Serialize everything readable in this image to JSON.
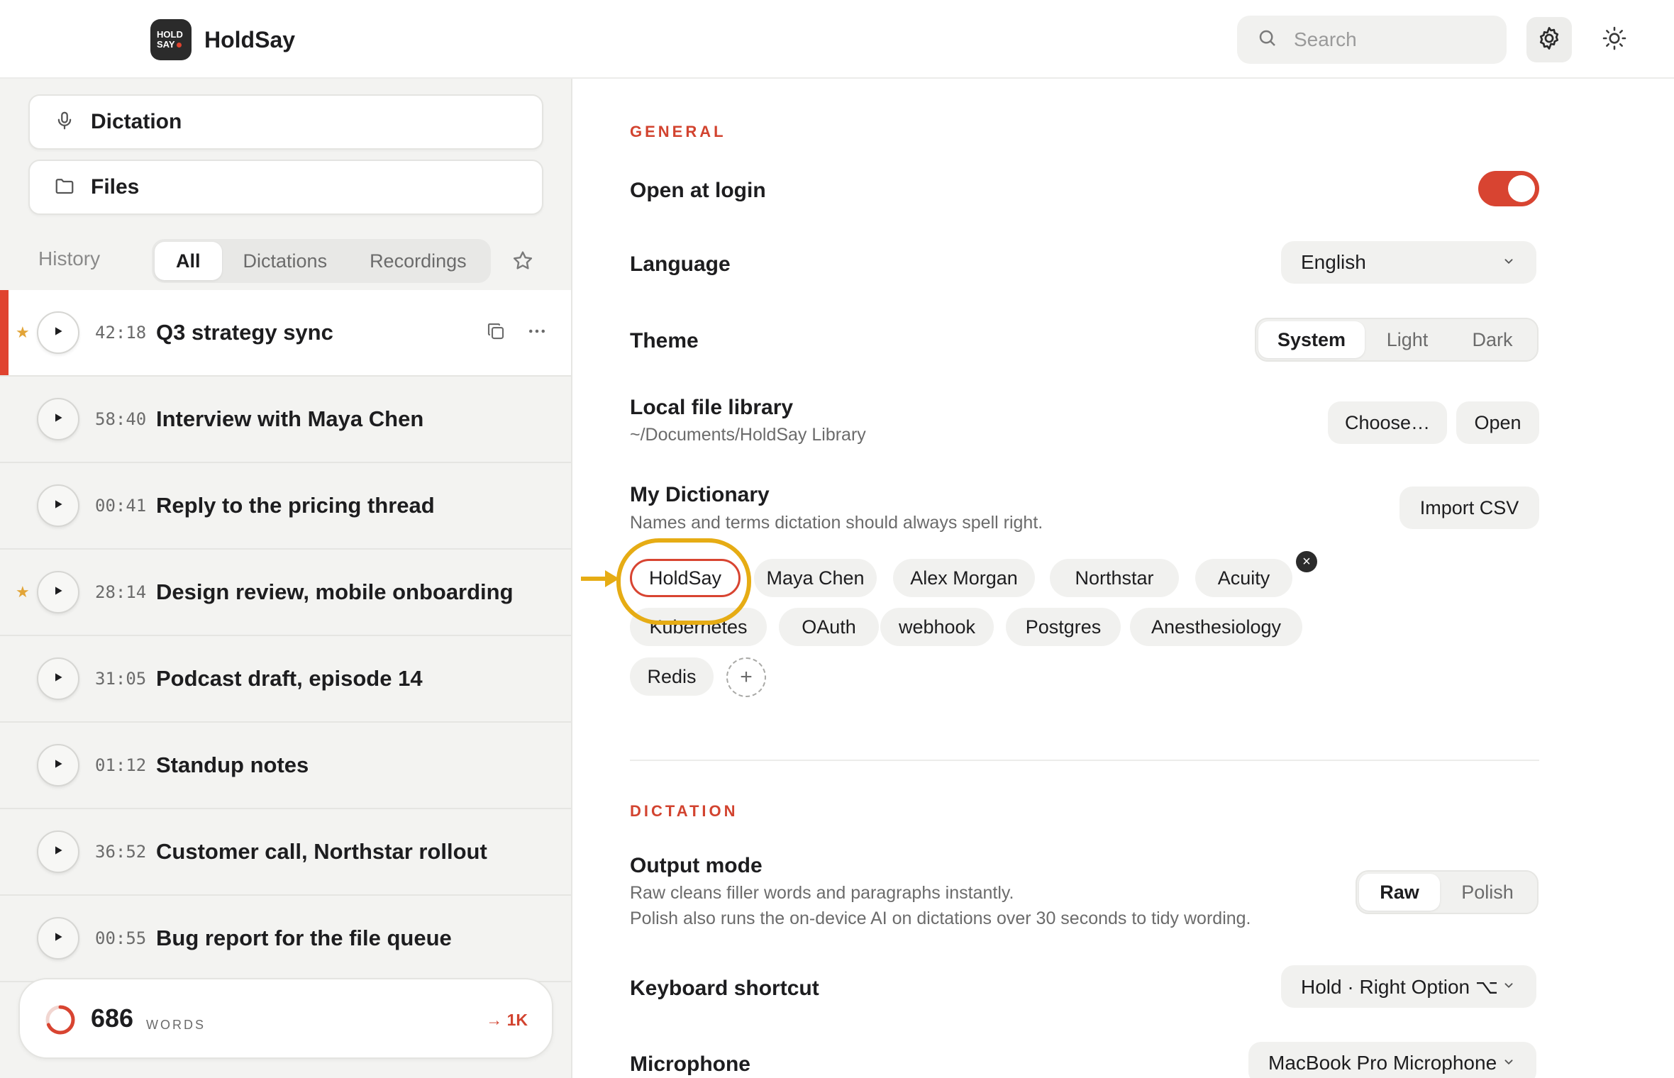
{
  "app": {
    "logo_line1": "HOLD",
    "logo_line2": "SAY",
    "name": "HoldSay"
  },
  "header": {
    "search_placeholder": "Search",
    "icons": [
      "search-icon",
      "gear-icon",
      "sun-icon"
    ]
  },
  "sidebar": {
    "nav": [
      {
        "label": "Dictation",
        "icon": "microphone-icon"
      },
      {
        "label": "Files",
        "icon": "folder-icon"
      }
    ],
    "history_label": "History",
    "filters": [
      "All",
      "Dictations",
      "Recordings"
    ],
    "active_filter": "All",
    "items": [
      {
        "duration": "42:18",
        "title": "Q3 strategy sync",
        "starred": true,
        "selected": true
      },
      {
        "duration": "58:40",
        "title": "Interview with Maya Chen",
        "starred": false,
        "selected": false
      },
      {
        "duration": "00:41",
        "title": "Reply to the pricing thread",
        "starred": false,
        "selected": false
      },
      {
        "duration": "28:14",
        "title": "Design review, mobile onboarding",
        "starred": true,
        "selected": false
      },
      {
        "duration": "31:05",
        "title": "Podcast draft, episode 14",
        "starred": false,
        "selected": false
      },
      {
        "duration": "01:12",
        "title": "Standup notes",
        "starred": false,
        "selected": false
      },
      {
        "duration": "36:52",
        "title": "Customer call, Northstar rollout",
        "starred": false,
        "selected": false
      },
      {
        "duration": "00:55",
        "title": "Bug report for the file queue",
        "starred": false,
        "selected": false
      }
    ],
    "words": {
      "count": "686",
      "unit": "WORDS",
      "goal": "→ 1K",
      "progress": 0.686
    }
  },
  "general": {
    "section": "GENERAL",
    "open_at_login": {
      "label": "Open at login",
      "enabled": true
    },
    "language": {
      "label": "Language",
      "value": "English"
    },
    "theme": {
      "label": "Theme",
      "options": [
        "System",
        "Light",
        "Dark"
      ],
      "selected": "System"
    },
    "library": {
      "label": "Local file library",
      "path": "~/Documents/HoldSay Library",
      "choose": "Choose…",
      "open": "Open"
    },
    "dictionary": {
      "label": "My Dictionary",
      "subtitle": "Names and terms dictation should always spell right.",
      "import": "Import CSV",
      "terms": [
        "HoldSay",
        "Maya Chen",
        "Alex Morgan",
        "Northstar",
        "Acuity",
        "Kubernetes",
        "OAuth",
        "webhook",
        "Postgres",
        "Anesthesiology",
        "Redis"
      ],
      "highlighted": "HoldSay",
      "add": "+"
    }
  },
  "dictation": {
    "section": "DICTATION",
    "output_mode": {
      "label": "Output mode",
      "line1": "Raw cleans filler words and paragraphs instantly.",
      "line2": "Polish also runs the on-device AI on dictations over 30 seconds to tidy wording.",
      "options": [
        "Raw",
        "Polish"
      ],
      "selected": "Raw"
    },
    "shortcut": {
      "label": "Keyboard shortcut",
      "value": "Hold · Right Option ⌥"
    },
    "microphone": {
      "label": "Microphone",
      "value": "MacBook Pro Microphone"
    }
  },
  "colors": {
    "accent": "#d84431",
    "star": "#e2a437",
    "callout": "#e6ac14"
  }
}
